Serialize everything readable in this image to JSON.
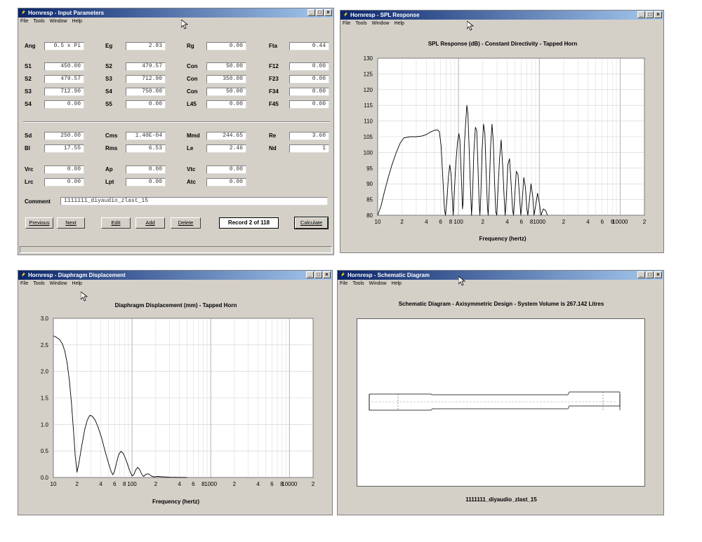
{
  "win1": {
    "title": "Hornresp - Input Parameters",
    "menu": [
      "File",
      "Tools",
      "Window",
      "Help"
    ],
    "params": [
      {
        "l": "Ang",
        "v": "0.5 x Pi"
      },
      {
        "l": "Eg",
        "v": "2.83"
      },
      {
        "l": "Rg",
        "v": "0.00"
      },
      {
        "l": "Fta",
        "v": "0.44"
      },
      {
        "l": "S1",
        "v": "450.00"
      },
      {
        "l": "S2",
        "v": "479.57"
      },
      {
        "l": "Con",
        "v": "50.00"
      },
      {
        "l": "F12",
        "v": "0.00"
      },
      {
        "l": "S2",
        "v": "479.57"
      },
      {
        "l": "S3",
        "v": "712.90"
      },
      {
        "l": "Con",
        "v": "350.00"
      },
      {
        "l": "F23",
        "v": "0.00"
      },
      {
        "l": "S3",
        "v": "712.90"
      },
      {
        "l": "S4",
        "v": "750.00"
      },
      {
        "l": "Con",
        "v": "50.00"
      },
      {
        "l": "F34",
        "v": "0.00"
      },
      {
        "l": "S4",
        "v": "0.00"
      },
      {
        "l": "S5",
        "v": "0.00"
      },
      {
        "l": "L45",
        "v": "0.00"
      },
      {
        "l": "F45",
        "v": "0.00"
      },
      {
        "l": "Sd",
        "v": "250.00"
      },
      {
        "l": "Cms",
        "v": "1.40E-04"
      },
      {
        "l": "Mmd",
        "v": "244.65"
      },
      {
        "l": "Re",
        "v": "3.60"
      },
      {
        "l": "Bl",
        "v": "17.55"
      },
      {
        "l": "Rms",
        "v": "6.53"
      },
      {
        "l": "Le",
        "v": "2.46"
      },
      {
        "l": "Nd",
        "v": "1"
      },
      {
        "l": "Vrc",
        "v": "0.00"
      },
      {
        "l": "Ap",
        "v": "0.00"
      },
      {
        "l": "Vtc",
        "v": "0.00"
      },
      {
        "l": "",
        "v": ""
      },
      {
        "l": "Lrc",
        "v": "0.00"
      },
      {
        "l": "Lpt",
        "v": "0.00"
      },
      {
        "l": "Atc",
        "v": "0.00"
      },
      {
        "l": "",
        "v": ""
      }
    ],
    "comment_label": "Comment",
    "comment_value": "1111111_diyaudio_zlast_15",
    "buttons": {
      "previous": "Previous",
      "next": "Next",
      "edit": "Edit",
      "add": "Add",
      "delete": "Delete",
      "calculate": "Calculate"
    },
    "record": "Record 2 of 118"
  },
  "win2": {
    "title": "Hornresp - SPL Response",
    "menu": [
      "File",
      "Tools",
      "Window",
      "Help"
    ]
  },
  "win3": {
    "title": "Hornresp - Diaphragm Displacement",
    "menu": [
      "File",
      "Tools",
      "Window",
      "Help"
    ]
  },
  "win4": {
    "title": "Hornresp - Schematic Diagram",
    "menu": [
      "File",
      "Tools",
      "Window",
      "Help"
    ],
    "heading": "Schematic Diagram - Axisymmetric Design - System Volume is 267.142 Litres",
    "footer": "1111111_diyaudio_zlast_15"
  },
  "chart_data": [
    {
      "type": "line",
      "title": "SPL Response (dB) - Constant Directivity - Tapped Horn",
      "xlabel": "Frequency (hertz)",
      "ylabel": "",
      "xscale": "log",
      "xlim": [
        10,
        20000
      ],
      "ylim": [
        80,
        130
      ],
      "yticks": [
        "80",
        "85",
        "90",
        "95",
        "100",
        "105",
        "110",
        "115",
        "120",
        "125",
        "130"
      ],
      "xtick_labels": [
        {
          "f": 10,
          "t": "10"
        },
        {
          "f": 20,
          "t": "2"
        },
        {
          "f": 40,
          "t": "4"
        },
        {
          "f": 60,
          "t": "6"
        },
        {
          "f": 80,
          "t": "8"
        },
        {
          "f": 100,
          "t": "100"
        },
        {
          "f": 200,
          "t": "2"
        },
        {
          "f": 400,
          "t": "4"
        },
        {
          "f": 600,
          "t": "6"
        },
        {
          "f": 800,
          "t": "8"
        },
        {
          "f": 1000,
          "t": "1000"
        },
        {
          "f": 2000,
          "t": "2"
        },
        {
          "f": 4000,
          "t": "4"
        },
        {
          "f": 6000,
          "t": "6"
        },
        {
          "f": 8000,
          "t": "8"
        },
        {
          "f": 10000,
          "t": "10000"
        },
        {
          "f": 20000,
          "t": "2"
        }
      ],
      "grid": true,
      "series": [
        {
          "values": [
            [
              10,
              80
            ],
            [
              11,
              83
            ],
            [
              12,
              87
            ],
            [
              13.5,
              92
            ],
            [
              15,
              96
            ],
            [
              17,
              100
            ],
            [
              19,
              103
            ],
            [
              21,
              104.6
            ],
            [
              25,
              105
            ],
            [
              30,
              105
            ],
            [
              35,
              105.2
            ],
            [
              40,
              105.7
            ],
            [
              45,
              106.5
            ],
            [
              50,
              107
            ],
            [
              55,
              107.2
            ],
            [
              58,
              106.6
            ],
            [
              61,
              102
            ],
            [
              64,
              92
            ],
            [
              67,
              82
            ],
            [
              69,
              80
            ],
            [
              72,
              85
            ],
            [
              75,
              92
            ],
            [
              78,
              96
            ],
            [
              81,
              93
            ],
            [
              84,
              85
            ],
            [
              86,
              80
            ],
            [
              89,
              88
            ],
            [
              93,
              97
            ],
            [
              97,
              103
            ],
            [
              101,
              106
            ],
            [
              104,
              104
            ],
            [
              107,
              96
            ],
            [
              110,
              88
            ],
            [
              112,
              82
            ],
            [
              114,
              84
            ],
            [
              118,
              102
            ],
            [
              123,
              110
            ],
            [
              127,
              115
            ],
            [
              131,
              112
            ],
            [
              136,
              100
            ],
            [
              141,
              88
            ],
            [
              145,
              80
            ],
            [
              149,
              86
            ],
            [
              155,
              100
            ],
            [
              162,
              108
            ],
            [
              168,
              107
            ],
            [
              174,
              96
            ],
            [
              180,
              84
            ],
            [
              184,
              80
            ],
            [
              189,
              86
            ],
            [
              196,
              101
            ],
            [
              204,
              109
            ],
            [
              212,
              106
            ],
            [
              220,
              94
            ],
            [
              228,
              83
            ],
            [
              233,
              80
            ],
            [
              240,
              88
            ],
            [
              250,
              102
            ],
            [
              260,
              109
            ],
            [
              270,
              103
            ],
            [
              280,
              90
            ],
            [
              290,
              81
            ],
            [
              298,
              80
            ],
            [
              308,
              88
            ],
            [
              322,
              98
            ],
            [
              337,
              104
            ],
            [
              352,
              96
            ],
            [
              367,
              86
            ],
            [
              378,
              80
            ],
            [
              390,
              85
            ],
            [
              408,
              96
            ],
            [
              428,
              98
            ],
            [
              448,
              90
            ],
            [
              466,
              82
            ],
            [
              480,
              80
            ],
            [
              496,
              86
            ],
            [
              520,
              94
            ],
            [
              545,
              93
            ],
            [
              570,
              86
            ],
            [
              590,
              80
            ],
            [
              612,
              84
            ],
            [
              642,
              92
            ],
            [
              672,
              89
            ],
            [
              702,
              82
            ],
            [
              722,
              80
            ],
            [
              750,
              84
            ],
            [
              790,
              90
            ],
            [
              830,
              86
            ],
            [
              860,
              80
            ],
            [
              900,
              83
            ],
            [
              950,
              87
            ],
            [
              1000,
              84
            ],
            [
              1050,
              80
            ],
            [
              1120,
              82
            ],
            [
              1200,
              81.5
            ],
            [
              1260,
              80
            ]
          ]
        }
      ]
    },
    {
      "type": "line",
      "title": "Diaphragm Displacement (mm) - Tapped Horn",
      "xlabel": "Frequency (hertz)",
      "ylabel": "",
      "xscale": "log",
      "xlim": [
        10,
        20000
      ],
      "ylim": [
        0,
        3
      ],
      "yticks": [
        "0.0",
        "0.5",
        "1.0",
        "1.5",
        "2.0",
        "2.5",
        "3.0"
      ],
      "xtick_labels": [
        {
          "f": 10,
          "t": "10"
        },
        {
          "f": 20,
          "t": "2"
        },
        {
          "f": 40,
          "t": "4"
        },
        {
          "f": 60,
          "t": "6"
        },
        {
          "f": 80,
          "t": "8"
        },
        {
          "f": 100,
          "t": "100"
        },
        {
          "f": 200,
          "t": "2"
        },
        {
          "f": 400,
          "t": "4"
        },
        {
          "f": 600,
          "t": "6"
        },
        {
          "f": 800,
          "t": "8"
        },
        {
          "f": 1000,
          "t": "1000"
        },
        {
          "f": 2000,
          "t": "2"
        },
        {
          "f": 4000,
          "t": "4"
        },
        {
          "f": 6000,
          "t": "6"
        },
        {
          "f": 8000,
          "t": "8"
        },
        {
          "f": 10000,
          "t": "10000"
        },
        {
          "f": 20000,
          "t": "2"
        }
      ],
      "grid": true,
      "series": [
        {
          "values": [
            [
              10,
              2.67
            ],
            [
              11,
              2.64
            ],
            [
              12,
              2.6
            ],
            [
              13,
              2.52
            ],
            [
              14,
              2.38
            ],
            [
              15,
              2.15
            ],
            [
              16,
              1.82
            ],
            [
              17,
              1.4
            ],
            [
              18,
              0.9
            ],
            [
              19,
              0.4
            ],
            [
              20,
              0.1
            ],
            [
              21,
              0.25
            ],
            [
              23,
              0.6
            ],
            [
              25,
              0.9
            ],
            [
              27,
              1.08
            ],
            [
              29,
              1.17
            ],
            [
              31,
              1.16
            ],
            [
              34,
              1.08
            ],
            [
              37,
              0.95
            ],
            [
              41,
              0.75
            ],
            [
              45,
              0.52
            ],
            [
              50,
              0.28
            ],
            [
              54,
              0.12
            ],
            [
              57,
              0.05
            ],
            [
              60,
              0.12
            ],
            [
              64,
              0.3
            ],
            [
              68,
              0.44
            ],
            [
              72,
              0.49
            ],
            [
              77,
              0.46
            ],
            [
              82,
              0.37
            ],
            [
              88,
              0.24
            ],
            [
              95,
              0.1
            ],
            [
              100,
              0.03
            ],
            [
              105,
              0.05
            ],
            [
              112,
              0.15
            ],
            [
              118,
              0.19
            ],
            [
              125,
              0.15
            ],
            [
              133,
              0.06
            ],
            [
              140,
              0.02
            ],
            [
              150,
              0.06
            ],
            [
              162,
              0.07
            ],
            [
              175,
              0.03
            ],
            [
              190,
              0.01
            ],
            [
              210,
              0.02
            ],
            [
              240,
              0.015
            ],
            [
              300,
              0.005
            ],
            [
              400,
              0.002
            ],
            [
              500,
              0.0
            ]
          ]
        }
      ]
    }
  ]
}
